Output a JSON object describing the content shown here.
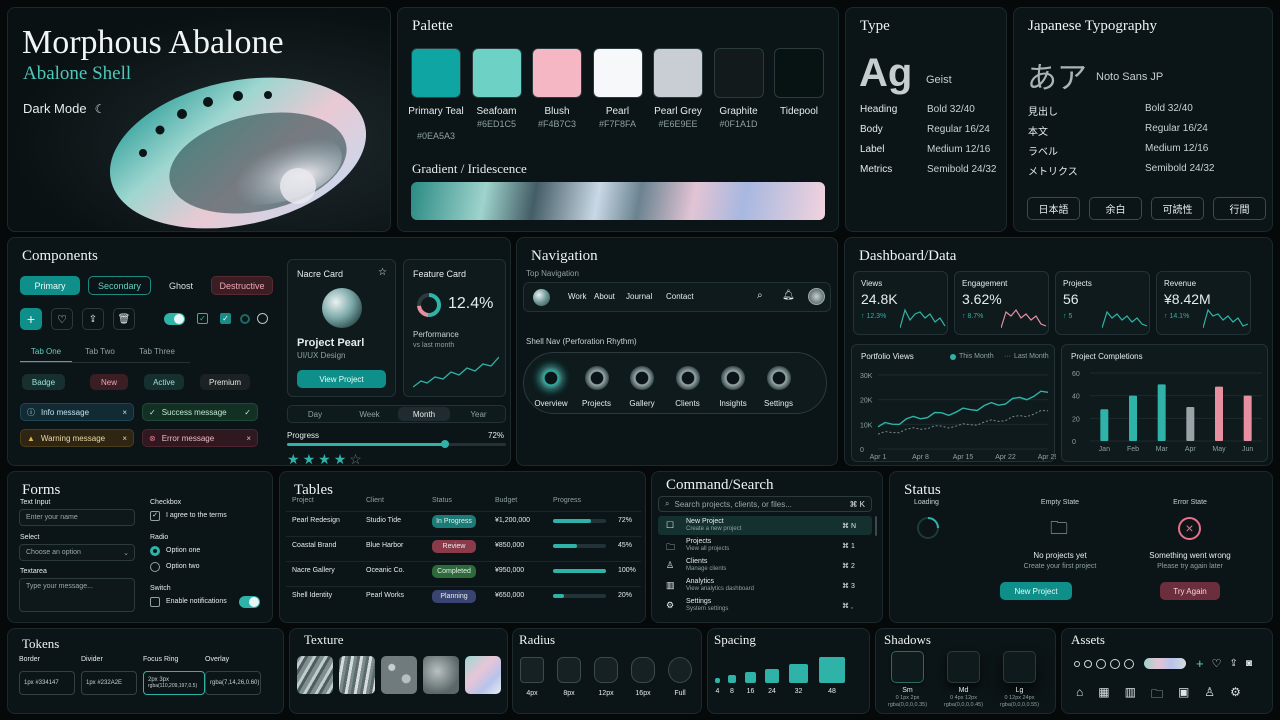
{
  "hero": {
    "title": "Morphous Abalone",
    "subtitle": "Abalone Shell",
    "mode": "Dark Mode"
  },
  "palette": {
    "title": "Palette",
    "swatches": [
      {
        "name": "Primary Teal",
        "hex": "#0EA5A3",
        "color": "#0EA5A3"
      },
      {
        "name": "Seafoam",
        "hex": "#6ED1C5",
        "color": "#6ED1C5"
      },
      {
        "name": "Blush",
        "hex": "#F4B7C3",
        "color": "#F4B7C3"
      },
      {
        "name": "Pearl",
        "hex": "#F7F8FA",
        "color": "#F7F8FA"
      },
      {
        "name": "Pearl Grey",
        "hex": "#E6E9EE",
        "color": "#C8CED4"
      },
      {
        "name": "Graphite",
        "hex": "#0F1A1D",
        "color": "#121a1c"
      },
      {
        "name": "Tidepool",
        "hex": "",
        "color": "#071312"
      }
    ],
    "gradient_title": "Gradient / Iridescence"
  },
  "type": {
    "title": "Type",
    "sample": "Ag",
    "font": "Geist",
    "rows": [
      {
        "k": "Heading",
        "v": "Bold 32/40"
      },
      {
        "k": "Body",
        "v": "Regular 16/24"
      },
      {
        "k": "Label",
        "v": "Medium 12/16"
      },
      {
        "k": "Metrics",
        "v": "Semibold 24/32"
      }
    ]
  },
  "jp": {
    "title": "Japanese Typography",
    "sample": "あア",
    "font": "Noto Sans JP",
    "rows": [
      {
        "k": "見出し",
        "v": "Bold 32/40"
      },
      {
        "k": "本文",
        "v": "Regular 16/24"
      },
      {
        "k": "ラベル",
        "v": "Medium 12/16"
      },
      {
        "k": "メトリクス",
        "v": "Semibold 24/32"
      }
    ],
    "chips": [
      "日本語",
      "余白",
      "可読性",
      "行間"
    ]
  },
  "components": {
    "title": "Components",
    "buttons": [
      "Primary",
      "Secondary",
      "Ghost",
      "Destructive"
    ],
    "tabs": [
      "Tab One",
      "Tab Two",
      "Tab Three"
    ],
    "badges": [
      "Badge",
      "New",
      "Active",
      "Premium"
    ],
    "alerts": [
      "Info message",
      "Success message",
      "Warning message",
      "Error message"
    ],
    "nacre": {
      "title": "Nacre Card",
      "name": "Project Pearl",
      "role": "UI/UX Design",
      "cta": "View Project"
    },
    "feature": {
      "title": "Feature Card",
      "value": "12.4%",
      "label": "Performance",
      "sub": "vs last month"
    },
    "segments": [
      "Day",
      "Week",
      "Month",
      "Year"
    ],
    "progress_label": "Progress",
    "progress_value": "72%",
    "progress": 0.72,
    "rating": 4,
    "rating_max": 5
  },
  "navigation": {
    "title": "Navigation",
    "top_label": "Top Navigation",
    "links": [
      "Work",
      "About",
      "Journal",
      "Contact"
    ],
    "shell_label": "Shell Nav (Perforation Rhythm)",
    "shell_items": [
      "Overview",
      "Projects",
      "Gallery",
      "Clients",
      "Insights",
      "Settings"
    ]
  },
  "dashboard": {
    "title": "Dashboard/Data",
    "kpis": [
      {
        "label": "Views",
        "value": "24.8K",
        "delta": "↑ 12.3%"
      },
      {
        "label": "Engagement",
        "value": "3.62%",
        "delta": "↑ 8.7%"
      },
      {
        "label": "Projects",
        "value": "56",
        "delta": "↑ 5"
      },
      {
        "label": "Revenue",
        "value": "¥8.42M",
        "delta": "↑ 14.1%"
      }
    ]
  },
  "chart_data": [
    {
      "type": "line",
      "title": "Portfolio Views",
      "x": [
        "Apr 1",
        "Apr 8",
        "Apr 15",
        "Apr 22",
        "Apr 29"
      ],
      "yticks": [
        "30K",
        "20K",
        "10K",
        "0"
      ],
      "ylim": [
        0,
        30000
      ],
      "series": [
        {
          "name": "This Month",
          "values": [
            9000,
            13000,
            15500,
            19000,
            23000
          ]
        },
        {
          "name": "Last Month",
          "values": [
            6000,
            8500,
            9500,
            12000,
            15500
          ]
        }
      ],
      "legend": "top-right"
    },
    {
      "type": "bar",
      "title": "Project Completions",
      "categories": [
        "Jan",
        "Feb",
        "Mar",
        "Apr",
        "May",
        "Jun"
      ],
      "values": [
        28,
        40,
        50,
        30,
        48,
        40
      ],
      "ylim": [
        0,
        60
      ],
      "yticks": [
        "60",
        "40",
        "20",
        "0"
      ],
      "colors": [
        "#2fb3a8",
        "#2fb3a8",
        "#2fb3a8",
        "#9aa3a8",
        "#e58fa0",
        "#e58fa0"
      ]
    }
  ],
  "forms": {
    "title": "Forms",
    "text_label": "Text Input",
    "text_placeholder": "Enter your name",
    "select_label": "Select",
    "select_value": "Choose an option",
    "textarea_label": "Textarea",
    "textarea_placeholder": "Type your message...",
    "checkbox_label": "Checkbox",
    "checkbox_text": "I agree to the terms",
    "radio_label": "Radio",
    "radio_options": [
      "Option one",
      "Option two"
    ],
    "switch_label": "Switch",
    "switch_text": "Enable notifications"
  },
  "tables": {
    "title": "Tables",
    "headers": [
      "Project",
      "Client",
      "Status",
      "Budget",
      "Progress"
    ],
    "rows": [
      {
        "project": "Pearl Redesign",
        "client": "Studio Tide",
        "status": "In Progress",
        "budget": "¥1,200,000",
        "progress": "72%",
        "p": 0.72,
        "sc": "#1b7c77"
      },
      {
        "project": "Coastal Brand",
        "client": "Blue Harbor",
        "status": "Review",
        "budget": "¥850,000",
        "progress": "45%",
        "p": 0.45,
        "sc": "#8a3b4a"
      },
      {
        "project": "Nacre Gallery",
        "client": "Oceanic Co.",
        "status": "Completed",
        "budget": "¥950,000",
        "progress": "100%",
        "p": 1,
        "sc": "#2d6a3a"
      },
      {
        "project": "Shell Identity",
        "client": "Pearl Works",
        "status": "Planning",
        "budget": "¥650,000",
        "progress": "20%",
        "p": 0.2,
        "sc": "#3a4470"
      }
    ]
  },
  "command": {
    "title": "Command/Search",
    "placeholder": "Search projects, clients, or files...",
    "shortcut": "⌘ K",
    "items": [
      {
        "t": "New Project",
        "s": "Create a new project",
        "k": "⌘ N"
      },
      {
        "t": "Projects",
        "s": "View all projects",
        "k": "⌘ 1"
      },
      {
        "t": "Clients",
        "s": "Manage clients",
        "k": "⌘ 2"
      },
      {
        "t": "Analytics",
        "s": "View analytics dashboard",
        "k": "⌘ 3"
      },
      {
        "t": "Settings",
        "s": "System settings",
        "k": "⌘ ,"
      }
    ]
  },
  "status": {
    "title": "Status",
    "loading": "Loading",
    "empty_label": "Empty State",
    "empty_title": "No projects yet",
    "empty_sub": "Create your first project",
    "empty_cta": "New Project",
    "error_label": "Error State",
    "error_title": "Something went wrong",
    "error_sub": "Please try again later",
    "error_cta": "Try Again"
  },
  "tokens": {
    "title": "Tokens",
    "items": [
      {
        "k": "Border",
        "v": "1px #334147"
      },
      {
        "k": "Divider",
        "v": "1px #232A2E"
      },
      {
        "k": "Focus Ring",
        "v": "2px 3px",
        "v2": "rgba(110,209,197,0.5)"
      },
      {
        "k": "Overlay",
        "v": "rgba(7,14,26,0.60)"
      }
    ]
  },
  "texture": {
    "title": "Texture"
  },
  "radius": {
    "title": "Radius",
    "items": [
      "4px",
      "8px",
      "12px",
      "16px",
      "Full"
    ]
  },
  "spacing": {
    "title": "Spacing",
    "items": [
      "4",
      "8",
      "16",
      "24",
      "32",
      "48"
    ]
  },
  "shadows": {
    "title": "Shadows",
    "items": [
      {
        "n": "Sm",
        "a": "0 1px 2px",
        "b": "rgba(0,0,0,0.35)"
      },
      {
        "n": "Md",
        "a": "0 4px 12px",
        "b": "rgba(0,0,0,0.45)"
      },
      {
        "n": "Lg",
        "a": "0 12px 24px",
        "b": "rgba(0,0,0,0.55)"
      }
    ]
  },
  "assets": {
    "title": "Assets"
  }
}
